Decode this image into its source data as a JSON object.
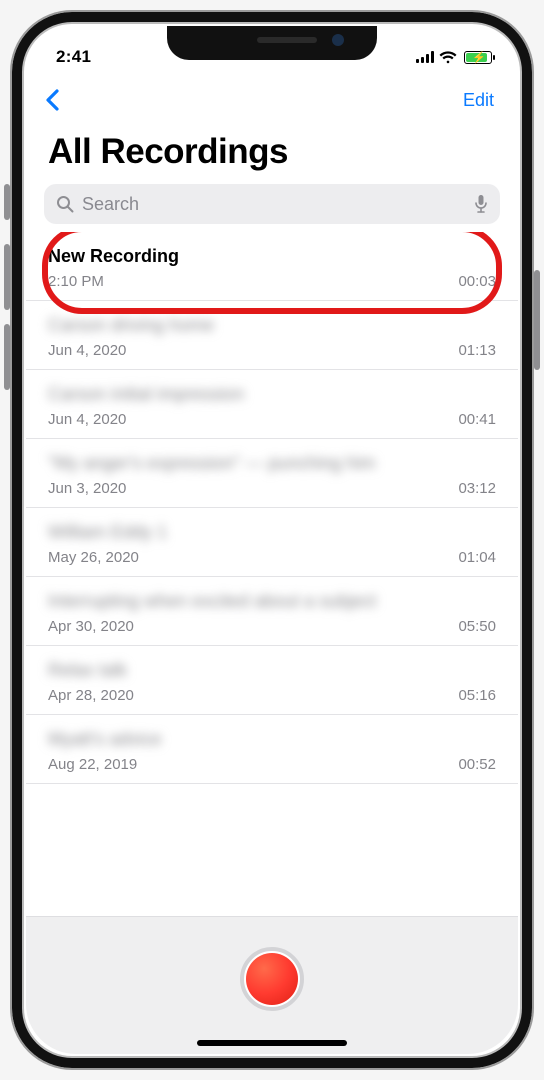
{
  "status": {
    "time": "2:41"
  },
  "nav": {
    "edit": "Edit"
  },
  "page_title": "All Recordings",
  "search": {
    "placeholder": "Search"
  },
  "recordings": [
    {
      "title": "New Recording",
      "date": "2:10 PM",
      "duration": "00:03",
      "blurred": false
    },
    {
      "title": "Carson driving home",
      "date": "Jun 4, 2020",
      "duration": "01:13",
      "blurred": true
    },
    {
      "title": "Carson initial impression",
      "date": "Jun 4, 2020",
      "duration": "00:41",
      "blurred": true
    },
    {
      "title": "\"My anger's expression\" — punching him",
      "date": "Jun 3, 2020",
      "duration": "03:12",
      "blurred": true
    },
    {
      "title": "William Eddy 1",
      "date": "May 26, 2020",
      "duration": "01:04",
      "blurred": true
    },
    {
      "title": "Interrupting when excited about a subject",
      "date": "Apr 30, 2020",
      "duration": "05:50",
      "blurred": true
    },
    {
      "title": "Relax talk",
      "date": "Apr 28, 2020",
      "duration": "05:16",
      "blurred": true
    },
    {
      "title": "Myatt's advice",
      "date": "Aug 22, 2019",
      "duration": "00:52",
      "blurred": true
    }
  ]
}
